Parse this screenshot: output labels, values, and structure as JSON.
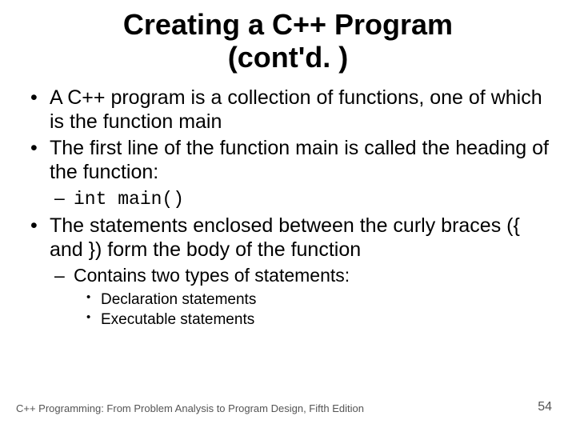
{
  "title_line1": "Creating a C++ Program",
  "title_line2": "(cont'd. )",
  "bullets": {
    "b1": "A C++ program is a collection of functions, one of which is the function main",
    "b2": "The first line of the function main is called the heading of the function:",
    "b2_sub1": "int main()",
    "b3": "The statements enclosed between the curly braces ({ and }) form the body of the function",
    "b3_sub1": "Contains two types of statements:",
    "b3_sub1_a": "Declaration statements",
    "b3_sub1_b": "Executable statements"
  },
  "footer_left": "C++ Programming: From Problem Analysis to Program Design, Fifth Edition",
  "footer_right": "54"
}
